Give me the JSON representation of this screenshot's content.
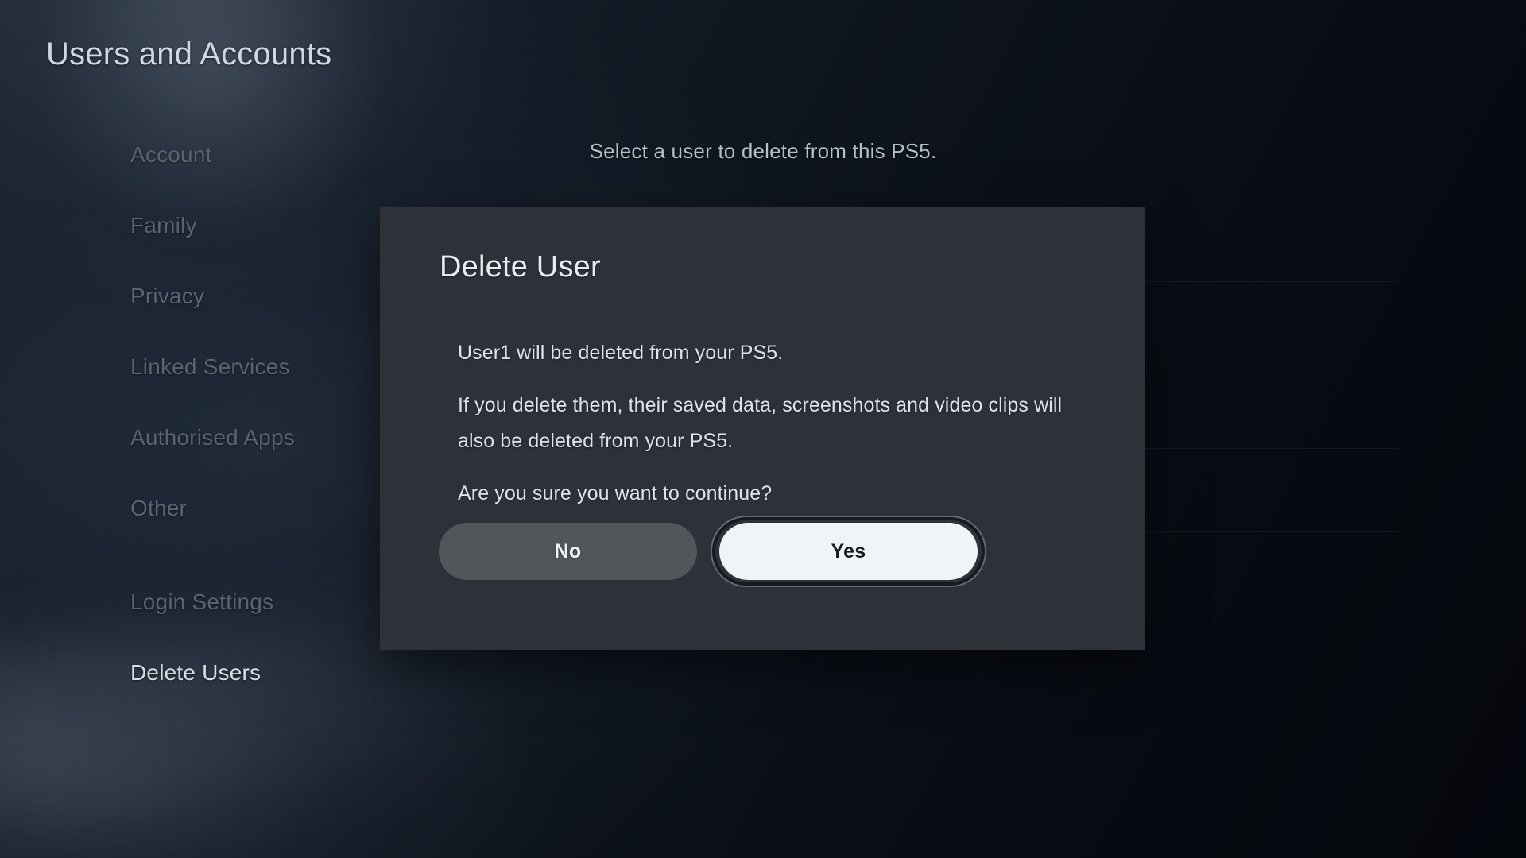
{
  "page": {
    "title": "Users and Accounts",
    "instruction": "Select a user to delete from this PS5."
  },
  "sidebar": {
    "items": [
      {
        "label": "Account",
        "selected": false
      },
      {
        "label": "Family",
        "selected": false
      },
      {
        "label": "Privacy",
        "selected": false
      },
      {
        "label": "Linked Services",
        "selected": false
      },
      {
        "label": "Authorised Apps",
        "selected": false
      },
      {
        "label": "Other",
        "selected": false
      },
      {
        "label": "Login Settings",
        "selected": false
      },
      {
        "label": "Delete Users",
        "selected": true
      }
    ]
  },
  "dialog": {
    "title": "Delete User",
    "paragraphs": [
      "User1 will be deleted from your PS5.",
      "If you delete them, their saved data, screenshots and video clips will also be deleted from your PS5.",
      "Are you sure you want to continue?"
    ],
    "buttons": {
      "no_label": "No",
      "yes_label": "Yes"
    }
  },
  "colors": {
    "dialog_background": "#2e3238",
    "primary_button_fill": "#eef4f8",
    "secondary_button_fill": "#52565b",
    "selected_nav_text": "#d8dee6",
    "dim_nav_text": "#596472"
  }
}
